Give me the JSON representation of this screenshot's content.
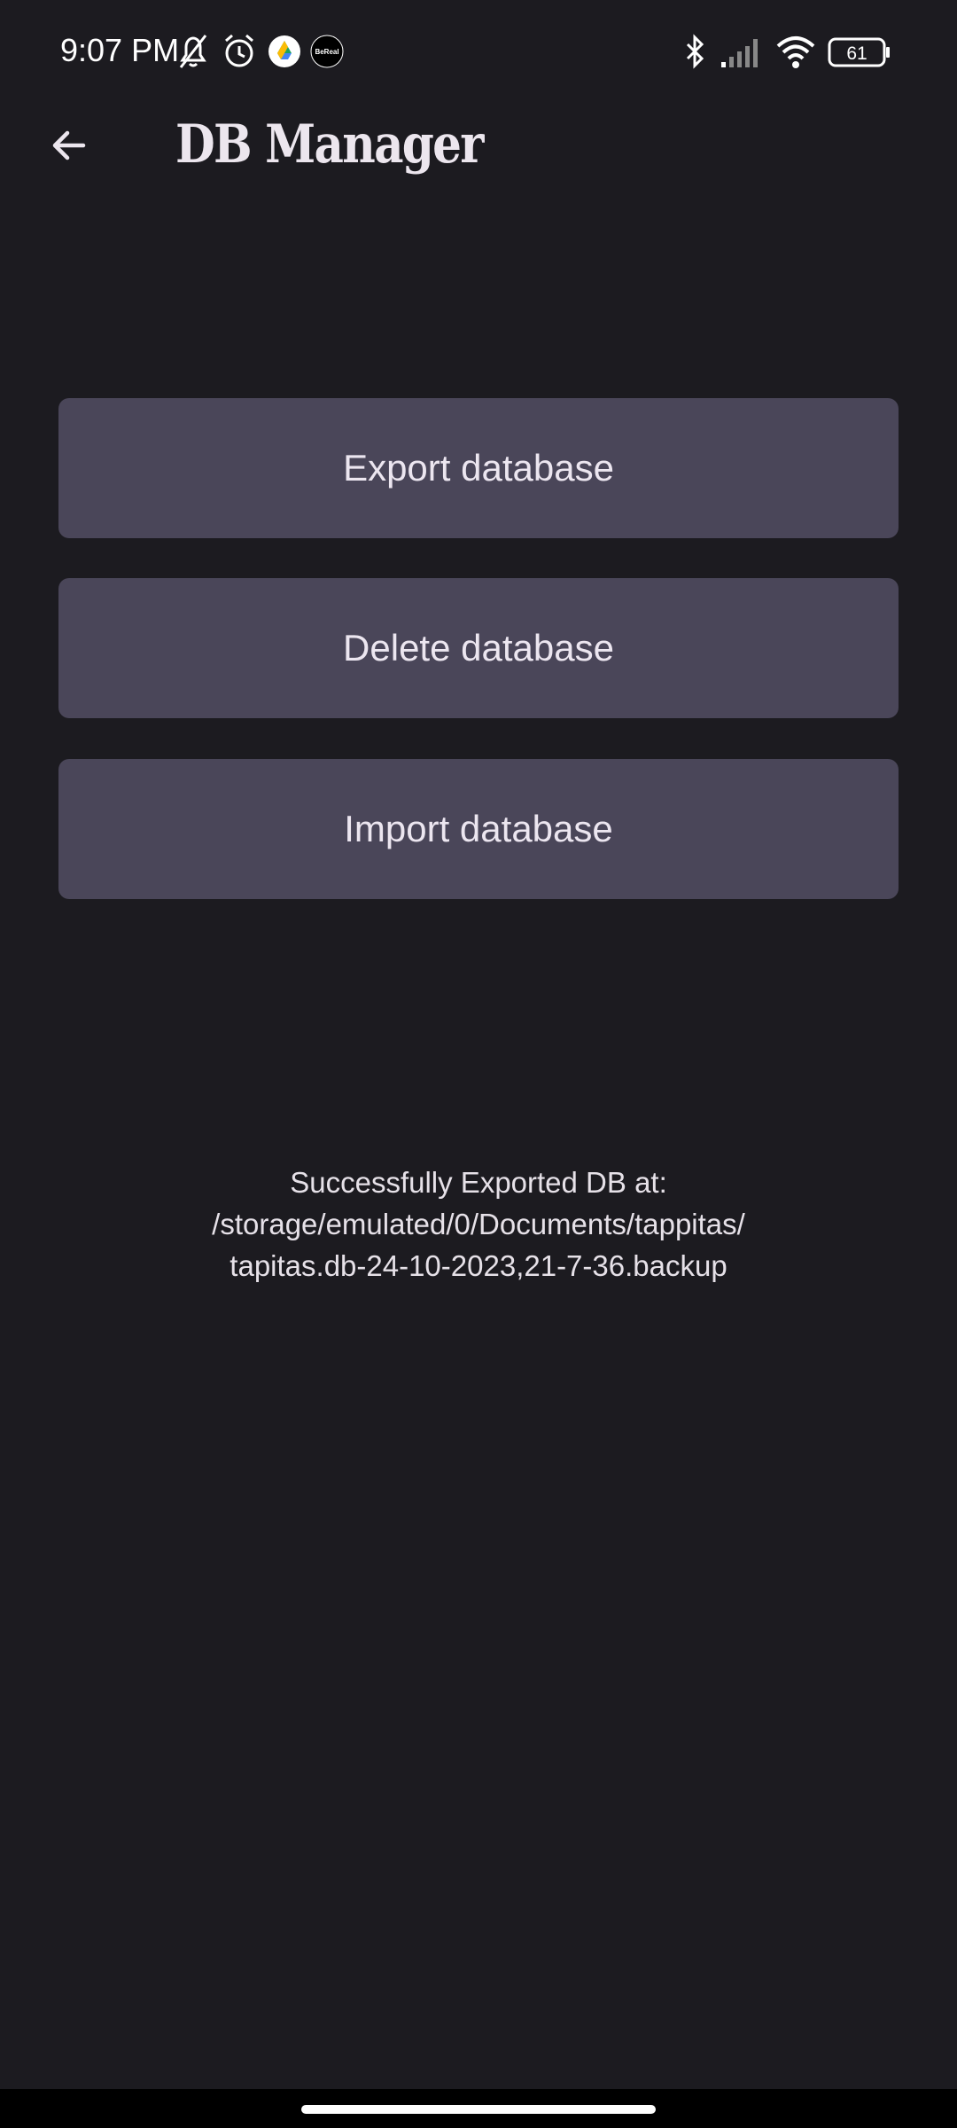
{
  "status_bar": {
    "time": "9:07 PM",
    "icons": [
      "notifications-off-icon",
      "alarm-icon",
      "google-drive-icon",
      "bereal-icon"
    ],
    "bereal_label": "BeReal",
    "right_icons": [
      "bluetooth-icon",
      "signal-icon",
      "wifi-icon",
      "battery-icon"
    ],
    "battery_level": "61"
  },
  "app_bar": {
    "back_icon": "arrow-back-icon",
    "title": "DB Manager"
  },
  "actions": {
    "export_label": "Export database",
    "delete_label": "Delete database",
    "import_label": "Import database"
  },
  "message": {
    "line1": "Successfully Exported DB at:",
    "line2": "/storage/emulated/0/Documents/tappitas/",
    "line3": "tapitas.db-24-10-2023,21-7-36.backup"
  },
  "colors": {
    "background": "#1c1b20",
    "button": "#4a4659",
    "text": "#ece6f0"
  }
}
